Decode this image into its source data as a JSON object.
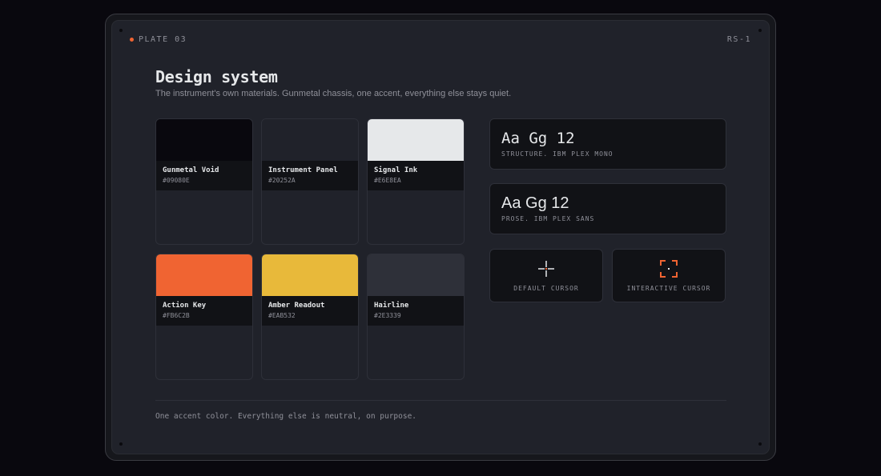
{
  "plate": {
    "label": "PLATE 03",
    "model": "RS-1",
    "accent_color": "#F06432"
  },
  "header": {
    "title": "Design system",
    "subtitle": "The instrument's own materials. Gunmetal chassis, one accent, everything else stays quiet."
  },
  "swatches": [
    {
      "name": "Gunmetal Void",
      "hex": "#09080E",
      "color": "#09080E"
    },
    {
      "name": "Instrument Panel",
      "hex": "#20252A",
      "color": "#20222A"
    },
    {
      "name": "Signal Ink",
      "hex": "#E6E8EA",
      "color": "#E6E8EA"
    },
    {
      "name": "Action Key",
      "hex": "#FB6C2B",
      "color": "#F06432"
    },
    {
      "name": "Amber Readout",
      "hex": "#EAB532",
      "color": "#E8B93A"
    },
    {
      "name": "Hairline",
      "hex": "#2E3339",
      "color": "#2E3039"
    }
  ],
  "typography": [
    {
      "sample": "Aa Gg 12",
      "caption": "STRUCTURE. IBM PLEX MONO"
    },
    {
      "sample": "Aa Gg 12",
      "caption": "PROSE. IBM PLEX SANS"
    }
  ],
  "cursors": [
    {
      "caption": "DEFAULT CURSOR",
      "icon": "crosshair-icon"
    },
    {
      "caption": "INTERACTIVE CURSOR",
      "icon": "focus-brackets-icon"
    }
  ],
  "footer": {
    "note": "One accent color. Everything else is neutral, on purpose."
  }
}
